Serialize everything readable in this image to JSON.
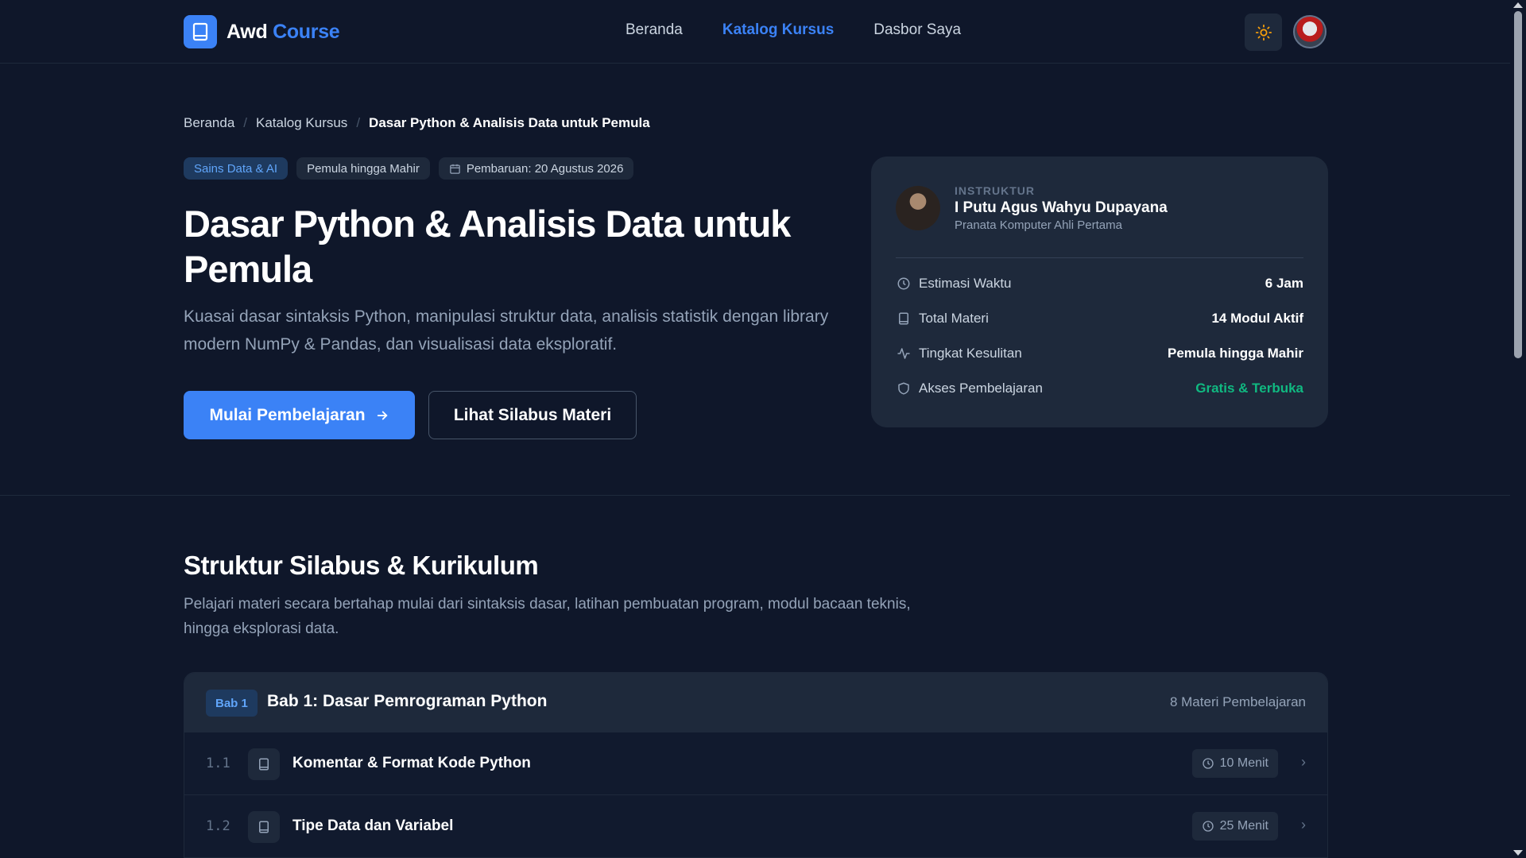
{
  "nav": {
    "brand_part1": "Awd",
    "brand_part2": "Course",
    "links": [
      "Beranda",
      "Katalog Kursus",
      "Dasbor Saya"
    ],
    "active_link": "Katalog Kursus"
  },
  "breadcrumb": [
    "Beranda",
    "Katalog Kursus",
    "Dasar Python & Analisis Data untuk Pemula"
  ],
  "tags": {
    "category": "Sains Data & AI",
    "level": "Pemula hingga Mahir",
    "updated": "Pembaruan: 20 Agustus 2026"
  },
  "hero": {
    "title": "Dasar Python & Analisis Data untuk Pemula",
    "description": "Kuasai dasar sintaksis Python, manipulasi struktur data, analisis statistik dengan library modern NumPy & Pandas, dan visualisasi data eksploratif.",
    "primary_button": "Mulai Pembelajaran",
    "secondary_button": "Lihat Silabus Materi"
  },
  "instructor": {
    "kicker": "INSTRUKTUR",
    "name": "I Putu Agus Wahyu Dupayana",
    "role": "Pranata Komputer Ahli Pertama",
    "stats": [
      {
        "label": "Estimasi Waktu",
        "value": "6 Jam",
        "icon": "clock-icon"
      },
      {
        "label": "Total Materi",
        "value": "14 Modul Aktif",
        "icon": "book-icon"
      },
      {
        "label": "Tingkat Kesulitan",
        "value": "Pemula hingga Mahir",
        "icon": "activity-icon"
      },
      {
        "label": "Akses Pembelajaran",
        "value": "Gratis & Terbuka",
        "icon": "shield-icon"
      }
    ]
  },
  "syllabus": {
    "title": "Struktur Silabus & Kurikulum",
    "description": "Pelajari materi secara bertahap mulai dari sintaksis dasar, latihan pembuatan program, modul bacaan teknis, hingga eksplorasi data.",
    "chapter": {
      "badge": "Bab 1",
      "title": "Bab 1: Dasar Pemrograman Python",
      "count": "8 Materi Pembelajaran",
      "lessons": [
        {
          "num": "1.1",
          "title": "Komentar & Format Kode Python",
          "duration": "10 Menit"
        },
        {
          "num": "1.2",
          "title": "Tipe Data dan Variabel",
          "duration": "25 Menit"
        }
      ]
    }
  },
  "colors": {
    "background": "#0f172a",
    "card": "#1e293b",
    "accent": "#3b82f6",
    "success": "#10b981"
  }
}
